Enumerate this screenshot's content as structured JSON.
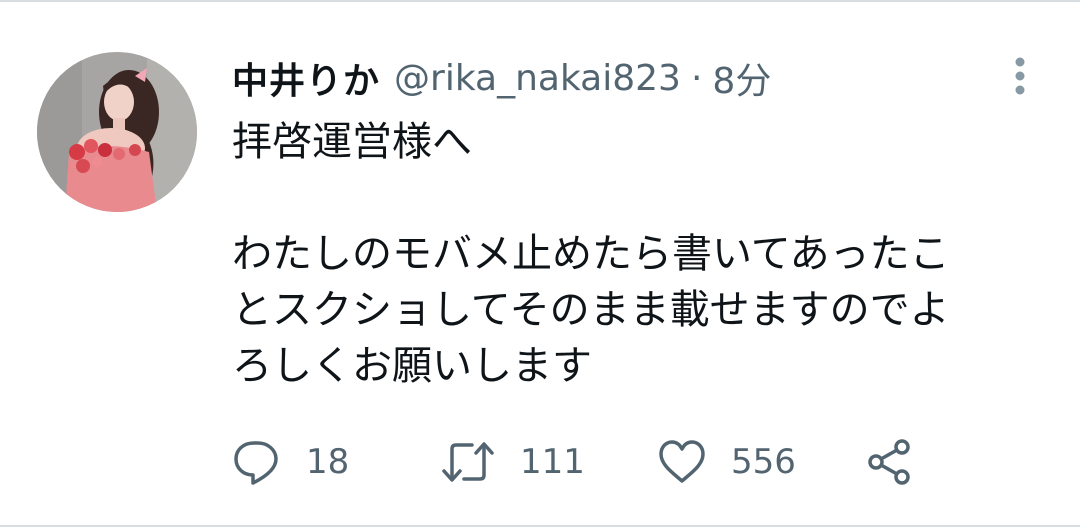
{
  "tweet": {
    "display_name": "中井りか",
    "handle": "@rika_nakai823",
    "separator": "·",
    "time": "8分",
    "text": {
      "line1": "拝啓運営様へ",
      "line2": "わたしのモバメ止めたら書いてあったこ",
      "line3": "とスクショしてそのまま載せますのでよ",
      "line4": "ろしくお願いします"
    }
  },
  "actions": {
    "reply_icon": "speech-bubble-icon",
    "reply_count": "18",
    "retweet_icon": "retweet-arrows-icon",
    "retweet_count": "111",
    "like_icon": "heart-icon",
    "like_count": "556",
    "share_icon": "share-nodes-icon"
  },
  "colors": {
    "text_primary": "#0f1419",
    "text_secondary": "#536471",
    "divider": "#d7dde1"
  }
}
